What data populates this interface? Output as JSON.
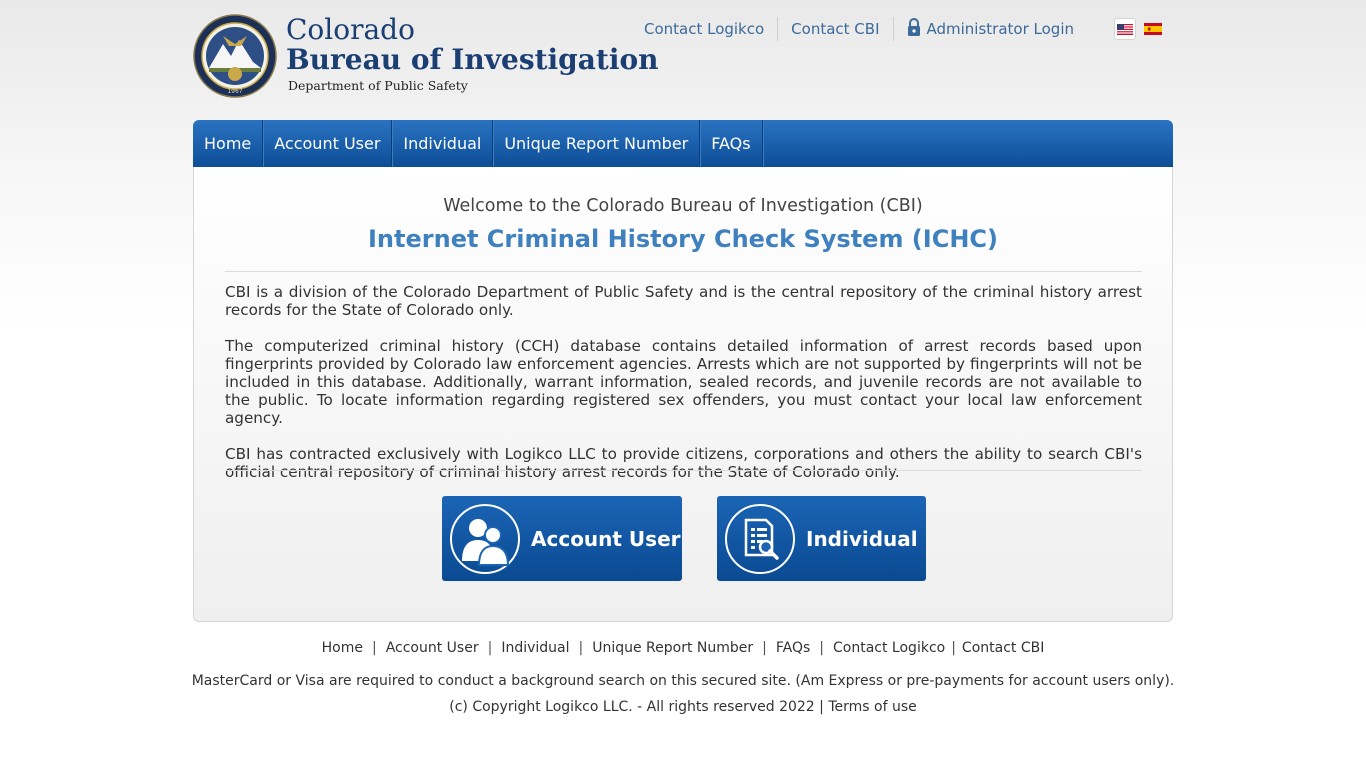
{
  "header": {
    "brand_line1": "Colorado",
    "brand_line2": "Bureau of Investigation",
    "brand_line3": "Department of Public Safety",
    "seal_text_top": "COLORADO BUREAU OF INVESTIGATION",
    "seal_year": "1967",
    "links": {
      "contact_logikco": "Contact Logikco",
      "contact_cbi": "Contact CBI",
      "admin_login": "Administrator Login"
    },
    "flags": [
      "us-flag-icon",
      "spain-flag-icon"
    ]
  },
  "nav": {
    "items": [
      "Home",
      "Account User",
      "Individual",
      "Unique Report Number",
      "FAQs"
    ]
  },
  "main": {
    "welcome": "Welcome to the Colorado Bureau of Investigation (CBI)",
    "title": "Internet Criminal History Check System (ICHC)",
    "paragraphs": [
      "CBI is a division of the Colorado Department of Public Safety and is the central repository of the criminal history arrest records for the State of Colorado only.",
      "The computerized criminal history (CCH) database contains detailed information of arrest records based upon fingerprints provided by Colorado law enforcement agencies. Arrests which are not supported by fingerprints will not be included in this database. Additionally, warrant information, sealed records, and juvenile records are not available to the public. To locate information regarding registered sex offenders, you must contact your local law enforcement agency.",
      "CBI has contracted exclusively with Logikco LLC to provide citizens, corporations and others the ability to search CBI's official central repository of criminal history arrest records for the State of Colorado only."
    ],
    "buttons": {
      "account_user": "Account User",
      "individual": "Individual"
    }
  },
  "footer": {
    "links": [
      "Home",
      "Account User",
      "Individual",
      "Unique Report Number",
      "FAQs",
      "Contact Logikco",
      "Contact CBI"
    ],
    "note": "MasterCard or Visa are required to conduct a background search on this secured site. (Am Express or pre-payments for account users only).",
    "copyright": "(c) Copyright Logikco LLC. - All rights reserved 2022",
    "terms": "Terms of use"
  },
  "colors": {
    "nav_blue": "#0d4d97",
    "title_blue": "#3f80bf",
    "link_blue": "#3c6a99",
    "brand_navy": "#1b3f73"
  }
}
